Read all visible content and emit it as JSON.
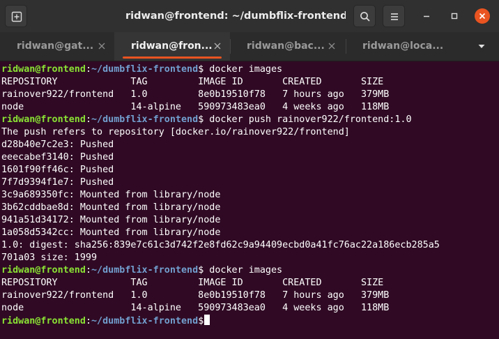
{
  "window": {
    "title": "ridwan@frontend: ~/dumbflix-frontend",
    "controls": {
      "minimize_icon": "minimize-icon",
      "maximize_icon": "maximize-icon",
      "close_icon": "close-icon"
    }
  },
  "header": {
    "new_tab_icon": "new-tab-icon",
    "search_icon": "search-icon",
    "menu_icon": "hamburger-menu-icon"
  },
  "tabs": [
    {
      "label": "ridwan@gat...",
      "active": false
    },
    {
      "label": "ridwan@fron...",
      "active": true
    },
    {
      "label": "ridwan@bac...",
      "active": false
    },
    {
      "label": "ridwan@loca...",
      "active": false
    }
  ],
  "colors": {
    "terminal_bg": "#300a24",
    "prompt_user": "#8ae234",
    "prompt_path": "#729fcf",
    "accent": "#e95420",
    "header_bg": "#303030"
  },
  "terminal": {
    "lines": [
      {
        "user": "ridwan@frontend",
        "sep": ":",
        "path": "~/dumbflix-frontend",
        "cmd": "$ docker images"
      },
      {
        "text": "REPOSITORY             TAG         IMAGE ID       CREATED       SIZE"
      },
      {
        "text": "rainover922/frontend   1.0         8e0b19510f78   7 hours ago   379MB"
      },
      {
        "text": "node                   14-alpine   590973483ea0   4 weeks ago   118MB"
      },
      {
        "user": "ridwan@frontend",
        "sep": ":",
        "path": "~/dumbflix-frontend",
        "cmd": "$ docker push rainover922/frontend:1.0"
      },
      {
        "text": "The push refers to repository [docker.io/rainover922/frontend]"
      },
      {
        "text": "d28b40e7c2e3: Pushed"
      },
      {
        "text": "eeecabef3140: Pushed"
      },
      {
        "text": "1601f90ff46c: Pushed"
      },
      {
        "text": "7f7d9394f1e7: Pushed"
      },
      {
        "text": "3c9a689350fc: Mounted from library/node"
      },
      {
        "text": "3b62cddbae8d: Mounted from library/node"
      },
      {
        "text": "941a51d34172: Mounted from library/node"
      },
      {
        "text": "1a058d5342cc: Mounted from library/node"
      },
      {
        "text": "1.0: digest: sha256:839e7c61c3d742f2e8fd62c9a94409ecbd0a41fc76ac22a186ecb285a5"
      },
      {
        "text": "701a03 size: 1999"
      },
      {
        "user": "ridwan@frontend",
        "sep": ":",
        "path": "~/dumbflix-frontend",
        "cmd": "$ docker images"
      },
      {
        "text": "REPOSITORY             TAG         IMAGE ID       CREATED       SIZE"
      },
      {
        "text": "rainover922/frontend   1.0         8e0b19510f78   7 hours ago   379MB"
      },
      {
        "text": "node                   14-alpine   590973483ea0   4 weeks ago   118MB"
      },
      {
        "user": "ridwan@frontend",
        "sep": ":",
        "path": "~/dumbflix-frontend",
        "cmd": "$"
      }
    ]
  }
}
